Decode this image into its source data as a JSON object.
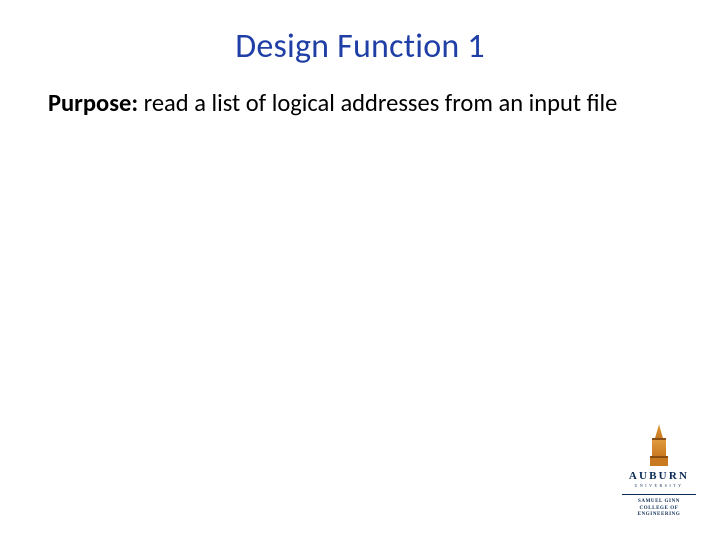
{
  "slide": {
    "title": "Design Function 1",
    "purpose_label": "Purpose:",
    "purpose_text": " read a list of logical addresses from an input file"
  },
  "logo": {
    "university": "AUBURN",
    "sub1": "UNIVERSITY",
    "sub2_line1": "SAMUEL GINN",
    "sub2_line2": "COLLEGE OF ENGINEERING"
  }
}
